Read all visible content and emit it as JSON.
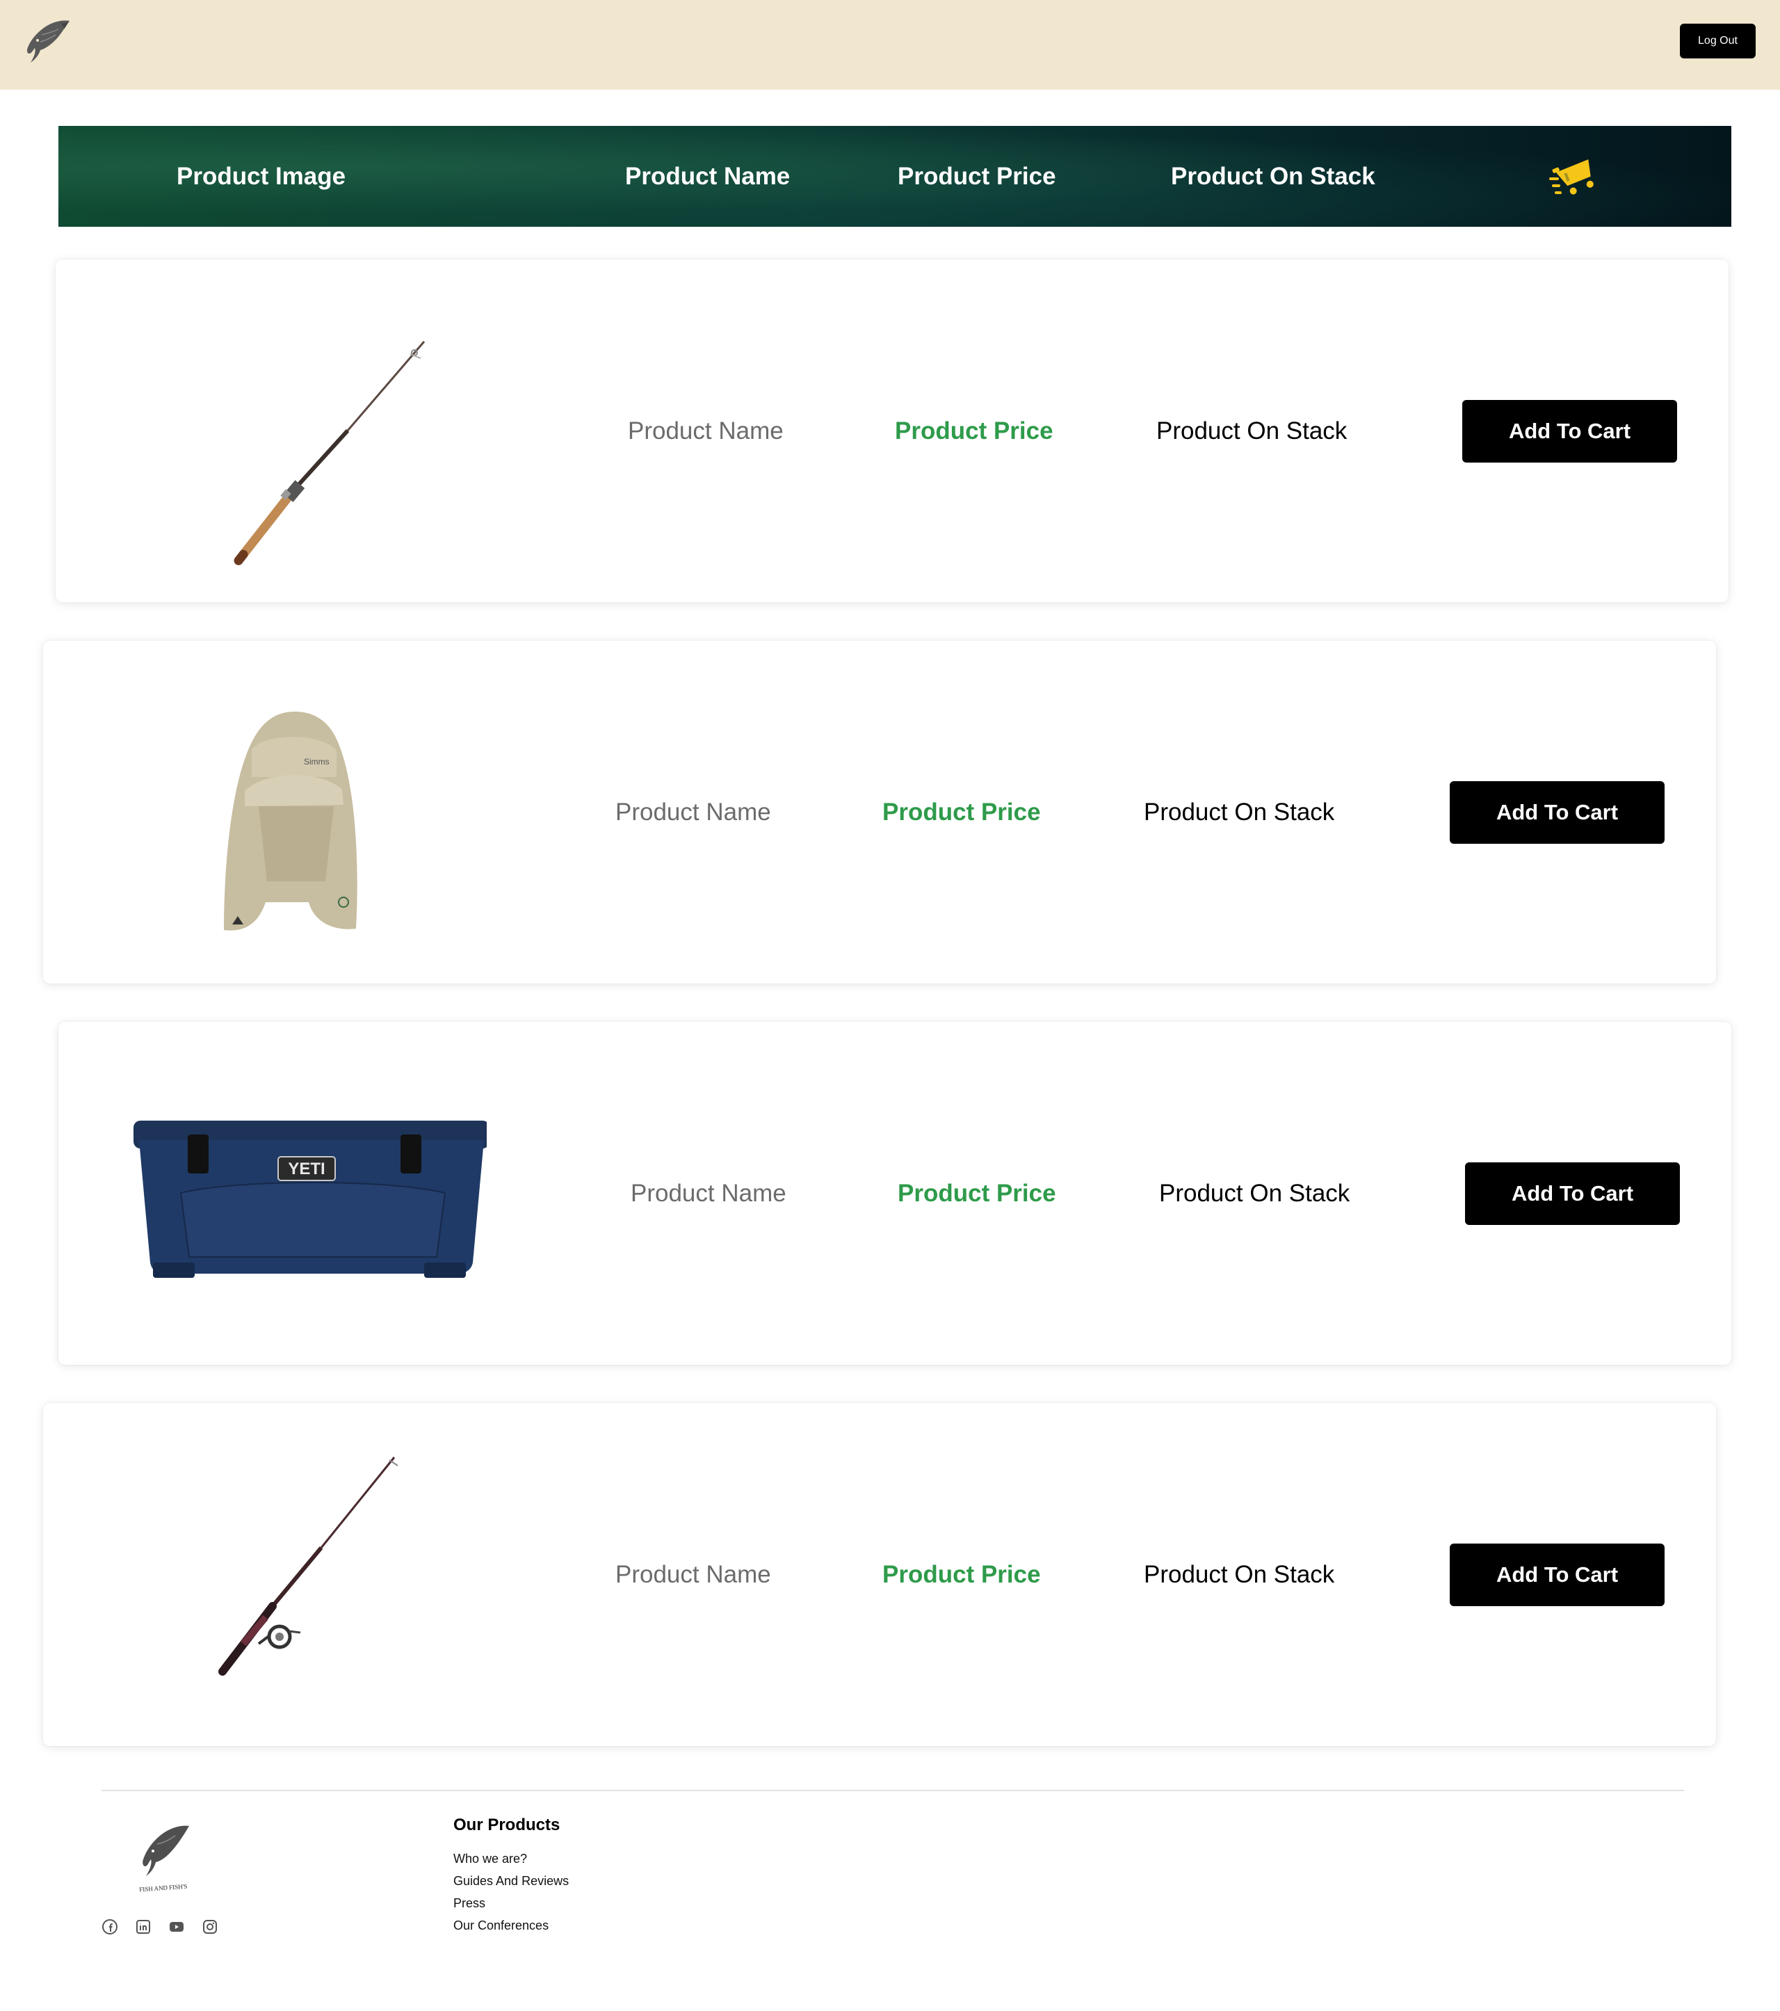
{
  "header": {
    "logout_label": "Log Out"
  },
  "table_header": {
    "image": "Product Image",
    "name": "Product Name",
    "price": "Product Price",
    "stock": "Product On Stack",
    "cart_icon": "cart-icon"
  },
  "products": [
    {
      "image_icon": "spinning-rod-image",
      "name": "Product Name",
      "price": "Product Price",
      "stock": "Product On Stack",
      "button": "Add To Cart"
    },
    {
      "image_icon": "sun-hat-image",
      "name": "Product Name",
      "price": "Product Price",
      "stock": "Product On Stack",
      "button": "Add To Cart"
    },
    {
      "image_icon": "cooler-image",
      "name": "Product Name",
      "price": "Product Price",
      "stock": "Product On Stack",
      "button": "Add To Cart"
    },
    {
      "image_icon": "rod-and-reel-image",
      "name": "Product Name",
      "price": "Product Price",
      "stock": "Product On Stack",
      "button": "Add To Cart"
    }
  ],
  "cooler_brand": "YETI",
  "footer": {
    "logo_text": "FISH AND FISH'S",
    "heading": "Our Products",
    "links": [
      "Who we are?",
      "Guides And Reviews",
      "Press",
      "Our Conferences"
    ],
    "social_icons": [
      "facebook-icon",
      "linkedin-icon",
      "youtube-icon",
      "instagram-icon"
    ]
  },
  "colors": {
    "topbar": "#f1e7cf",
    "price_green": "#2e9b4a",
    "cart_yellow": "#f5c518",
    "header_green": "#0b3a33"
  }
}
